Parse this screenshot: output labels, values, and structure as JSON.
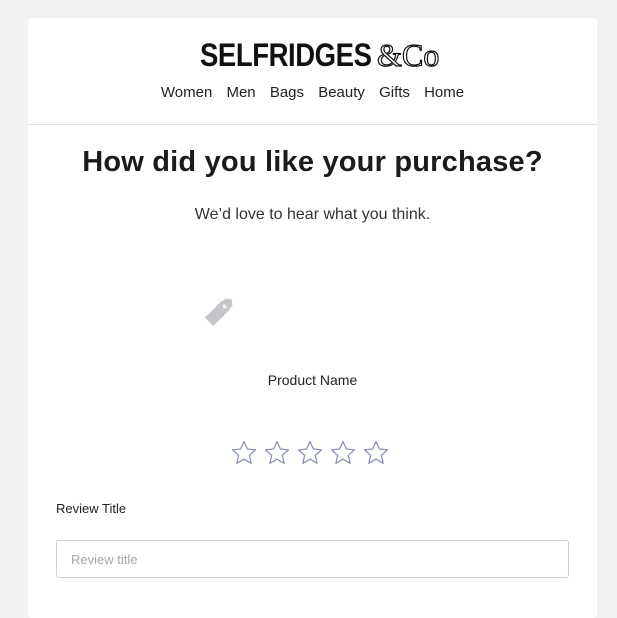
{
  "brand": {
    "name_main": "SELFRIDGES",
    "name_suffix": "&Co"
  },
  "nav": {
    "items": [
      {
        "label": "Women"
      },
      {
        "label": "Men"
      },
      {
        "label": "Bags"
      },
      {
        "label": "Beauty"
      },
      {
        "label": "Gifts"
      },
      {
        "label": "Home"
      }
    ]
  },
  "main": {
    "headline": "How did you like your purchase?",
    "subhead": "We’d love to hear what you think.",
    "product": {
      "icon": "tag-icon",
      "name": "Product Name"
    },
    "rating": {
      "max": 5,
      "selected": 0,
      "star_icon": "star-outline-icon",
      "star_color": "#8a93b3"
    },
    "review_title": {
      "label": "Review Title",
      "placeholder": "Review title",
      "value": ""
    }
  },
  "colors": {
    "page_bg": "#f2f2f2",
    "card_bg": "#ffffff",
    "divider": "#e2e2e2",
    "tag_icon": "#c4c6cc"
  }
}
